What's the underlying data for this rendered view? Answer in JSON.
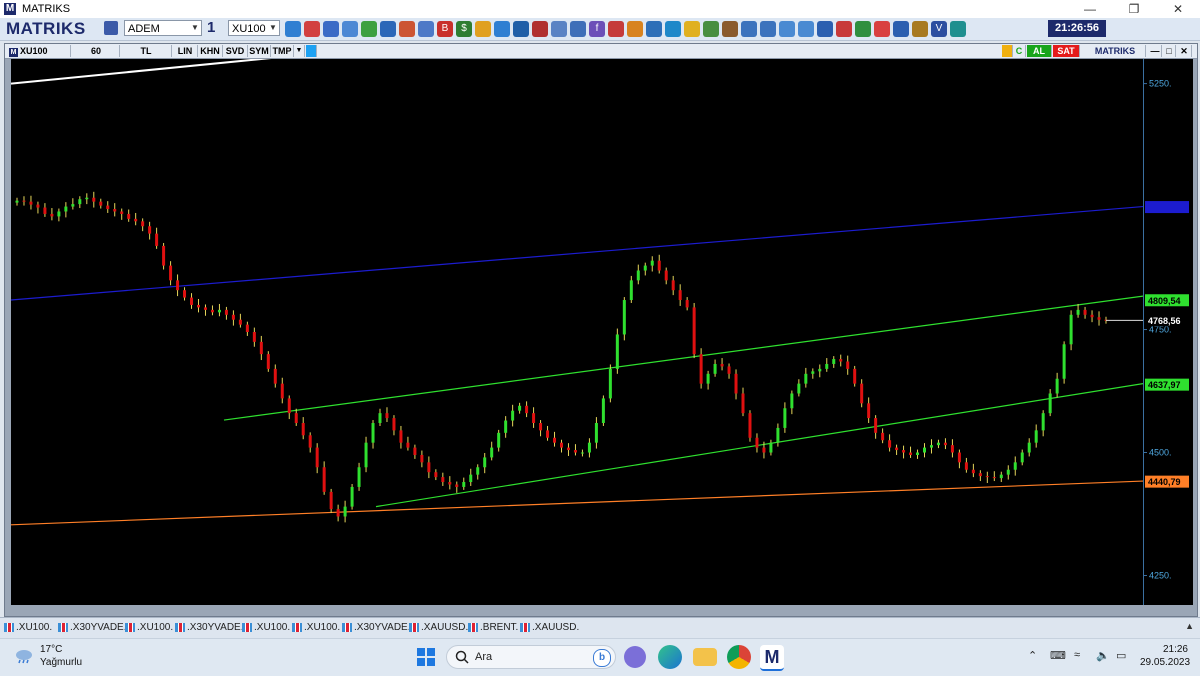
{
  "window": {
    "title": "MATRIKS",
    "brand": "MATRIKS"
  },
  "toolbar": {
    "user": "ADEM",
    "window_no": "1",
    "symbol": "XU100",
    "clock": "21:26:56"
  },
  "chart_header": {
    "symbol": "XU100",
    "period": "60",
    "currency": "TL",
    "buttons": [
      "LIN",
      "KHN",
      "SVD",
      "SYM",
      "TMP"
    ],
    "buy_label": "AL",
    "sell_label": "SAT",
    "brand": "MATRIKS",
    "c_label": "C"
  },
  "chart_data": {
    "type": "candlestick",
    "title": "XU100",
    "ylim": [
      4190,
      5300
    ],
    "y_ticks": [
      5250,
      4750,
      4500,
      4250
    ],
    "y_tick_labels": [
      "5250.",
      "4750.",
      "4500.",
      "4250."
    ],
    "last_price": 4768.56,
    "level_labels": [
      {
        "value": 4999.0,
        "label": "",
        "color": "#1c1ccf"
      },
      {
        "value": 4809.54,
        "label": "4809,54",
        "color": "#2fe02f"
      },
      {
        "value": 4768.56,
        "label": "4768,56",
        "color": "#000000"
      },
      {
        "value": 4637.97,
        "label": "4637,97",
        "color": "#2fe02f"
      },
      {
        "value": 4440.79,
        "label": "4440,79",
        "color": "#ff7f27"
      }
    ],
    "trendlines": [
      {
        "name": "white-line",
        "color": "#ffffff",
        "points": [
          [
            0,
            5250
          ],
          [
            350,
            5320
          ]
        ]
      },
      {
        "name": "blue-resistance",
        "color": "#1c1ccf",
        "points": [
          [
            0,
            4810
          ],
          [
            1132,
            5000
          ]
        ]
      },
      {
        "name": "green-upper-channel",
        "color": "#2fe02f",
        "points": [
          [
            213,
            4566
          ],
          [
            1132,
            4818
          ]
        ]
      },
      {
        "name": "green-lower-channel",
        "color": "#2fe02f",
        "points": [
          [
            365,
            4390
          ],
          [
            1132,
            4640
          ]
        ]
      },
      {
        "name": "orange-support",
        "color": "#ff7f27",
        "points": [
          [
            0,
            4353
          ],
          [
            1132,
            4442
          ]
        ]
      }
    ],
    "closes": [
      5012,
      5010,
      5004,
      4998,
      4985,
      4980,
      4990,
      5000,
      5005,
      5015,
      5018,
      5010,
      5002,
      4995,
      4990,
      4985,
      4975,
      4970,
      4960,
      4945,
      4920,
      4880,
      4850,
      4830,
      4815,
      4800,
      4795,
      4790,
      4785,
      4790,
      4780,
      4770,
      4760,
      4745,
      4725,
      4700,
      4670,
      4640,
      4610,
      4580,
      4560,
      4535,
      4510,
      4470,
      4420,
      4385,
      4370,
      4390,
      4430,
      4470,
      4520,
      4560,
      4580,
      4570,
      4545,
      4520,
      4510,
      4495,
      4480,
      4460,
      4450,
      4440,
      4435,
      4430,
      4440,
      4455,
      4470,
      4490,
      4510,
      4540,
      4565,
      4585,
      4595,
      4580,
      4560,
      4545,
      4530,
      4520,
      4510,
      4505,
      4500,
      4500,
      4520,
      4560,
      4610,
      4670,
      4740,
      4810,
      4850,
      4870,
      4880,
      4890,
      4870,
      4850,
      4830,
      4810,
      4795,
      4700,
      4640,
      4660,
      4680,
      4675,
      4660,
      4620,
      4580,
      4530,
      4510,
      4500,
      4520,
      4550,
      4590,
      4620,
      4640,
      4660,
      4665,
      4670,
      4680,
      4690,
      4685,
      4670,
      4640,
      4600,
      4570,
      4540,
      4525,
      4510,
      4505,
      4500,
      4495,
      4500,
      4510,
      4515,
      4520,
      4515,
      4500,
      4480,
      4465,
      4458,
      4452,
      4450,
      4448,
      4455,
      4465,
      4480,
      4500,
      4520,
      4545,
      4580,
      4620,
      4650,
      4720,
      4780,
      4790,
      4780,
      4775,
      4770,
      4768
    ]
  },
  "bottom_tabs": [
    ".XU100.",
    ".X30YVADE.",
    ".XU100.",
    ".X30YVADE.",
    ".XU100.",
    ".XU100.",
    ".X30YVADE.",
    ".XAUUSD.",
    ".BRENT.",
    ".XAUUSD."
  ],
  "taskbar": {
    "temperature": "17°C",
    "weather_text": "Yağmurlu",
    "search_placeholder": "Ara",
    "time": "21:26",
    "date": "29.05.2023"
  },
  "colors": {
    "bull": "#2fe02f",
    "bear": "#e01010",
    "wick": "#e6d65a",
    "accent": "#1d2a6b"
  }
}
